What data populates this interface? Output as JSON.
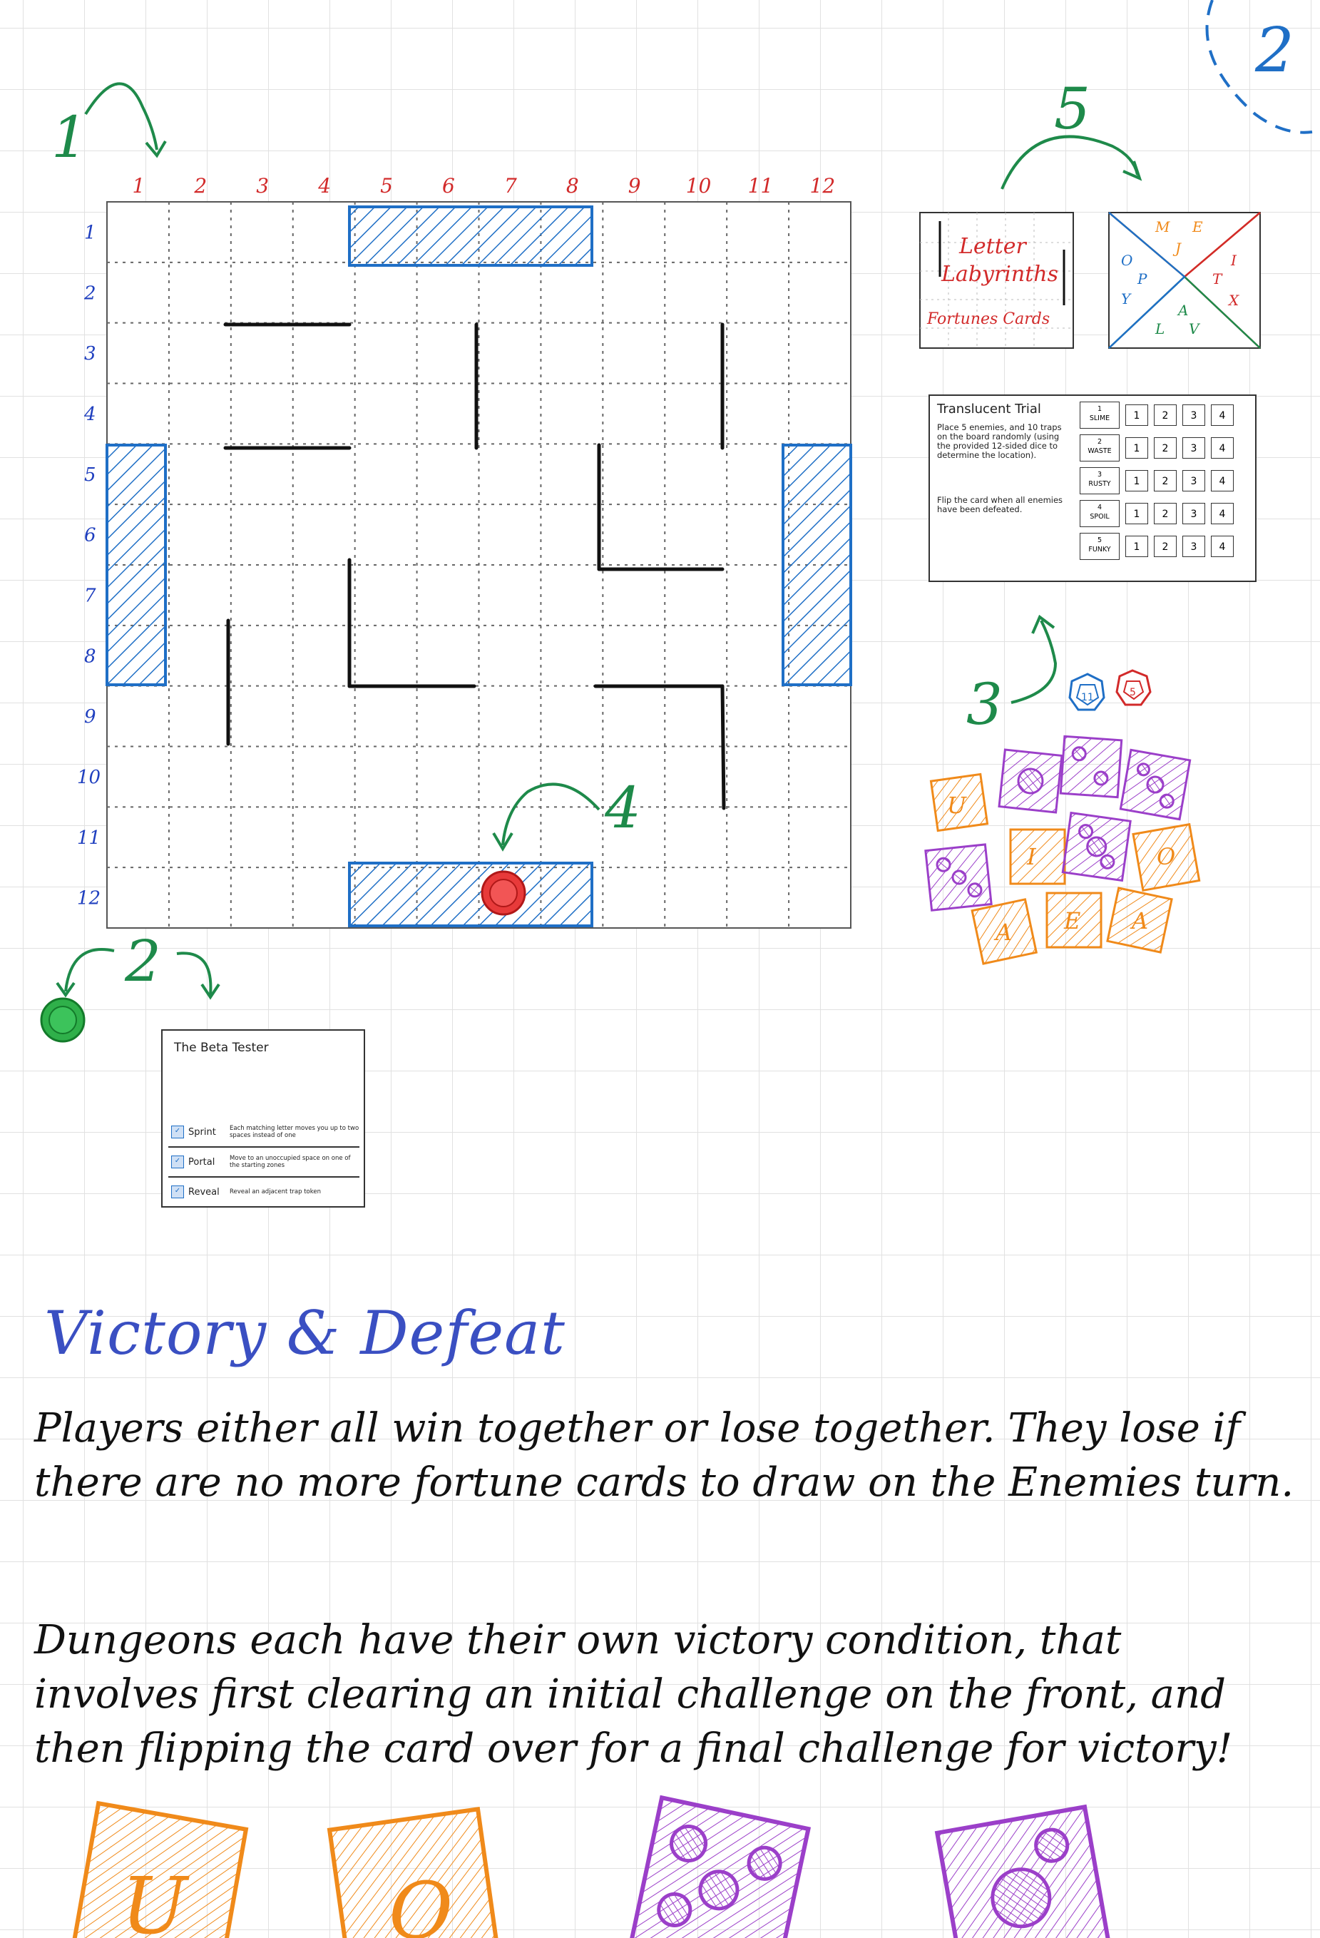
{
  "page_number": "2",
  "colors": {
    "green": "#1e8a4a",
    "blue": "#1f6fc6",
    "red": "#d22a2a",
    "orange": "#f08a1a",
    "purple": "#9b3fc9",
    "black": "#111111",
    "accent_blue": "#3a4fc2"
  },
  "callouts": {
    "c1": "1",
    "c2": "2",
    "c3": "3",
    "c4": "4",
    "c5": "5"
  },
  "board": {
    "col_labels": [
      "1",
      "2",
      "3",
      "4",
      "5",
      "6",
      "7",
      "8",
      "9",
      "10",
      "11",
      "12"
    ],
    "row_labels": [
      "1",
      "2",
      "3",
      "4",
      "5",
      "6",
      "7",
      "8",
      "9",
      "10",
      "11",
      "12"
    ]
  },
  "fortune_card": {
    "line1": "Letter",
    "line2": "Labyrinths",
    "line3": "Fortunes Cards"
  },
  "letter_card": {
    "letters": [
      "M",
      "E",
      "J",
      "I",
      "O",
      "P",
      "T",
      "Y",
      "A",
      "X",
      "L",
      "V"
    ]
  },
  "dungeon_card": {
    "title": "Translucent Trial",
    "body1": "Place 5 enemies, and 10 traps on the board randomly (using the provided 12-sided dice to determine the location).",
    "body2": "Flip the card when all enemies have been defeated.",
    "enemies": [
      {
        "num": "1",
        "name": "SLIME",
        "cells": [
          "1",
          "2",
          "3",
          "4"
        ]
      },
      {
        "num": "2",
        "name": "WASTE",
        "cells": [
          "1",
          "2",
          "3",
          "4"
        ]
      },
      {
        "num": "3",
        "name": "RUSTY",
        "cells": [
          "1",
          "2",
          "3",
          "4"
        ]
      },
      {
        "num": "4",
        "name": "SPOIL",
        "cells": [
          "1",
          "2",
          "3",
          "4"
        ]
      },
      {
        "num": "5",
        "name": "FUNKY",
        "cells": [
          "1",
          "2",
          "3",
          "4"
        ]
      }
    ]
  },
  "dice": {
    "blue_face": "11",
    "red_face": "5"
  },
  "tokens": {
    "letters": [
      "U",
      "I",
      "O",
      "A",
      "E",
      "A"
    ]
  },
  "hero_card": {
    "title": "The Beta Tester",
    "abilities": [
      {
        "name": "Sprint",
        "desc": "Each matching letter moves you up to two spaces instead of one"
      },
      {
        "name": "Portal",
        "desc": "Move to an unoccupied space on one of the starting zones"
      },
      {
        "name": "Reveal",
        "desc": "Reveal an adjacent trap token"
      }
    ]
  },
  "section": {
    "heading": "Victory & Defeat",
    "para1": "Players either all win together or lose together. They lose if there are no more fortune cards to draw on the Enemies turn.",
    "para2": "Dungeons each have their own victory condition, that involves first clearing an initial challenge on the front, and then flipping the card over for a final challenge for victory!"
  },
  "bottom_tokens": {
    "letters": [
      "U",
      "O"
    ]
  }
}
